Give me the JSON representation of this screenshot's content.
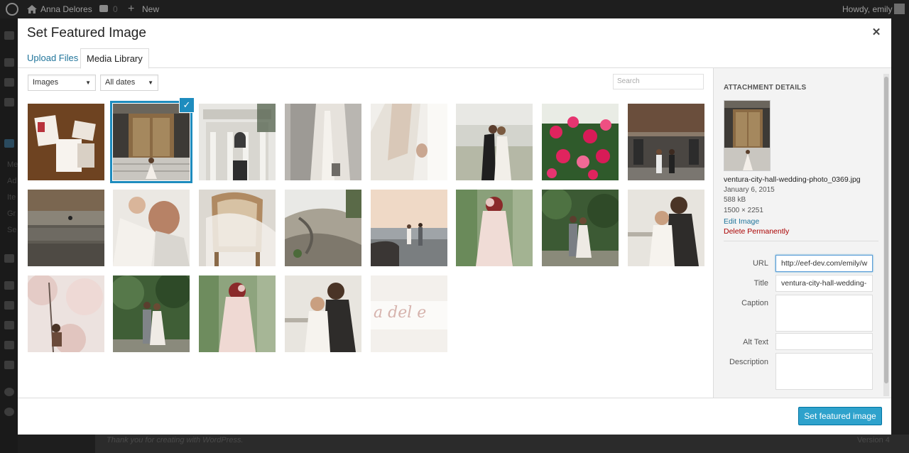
{
  "admin_bar": {
    "site_name": "Anna Delores",
    "comments_count": "0",
    "new_label": "New",
    "greeting": "Howdy, emily"
  },
  "side_menu": {
    "items": [
      "Me",
      "Ad",
      "Ite",
      "Gr",
      "Se"
    ]
  },
  "background_footer": {
    "thanks_text": "Thank you for creating with WordPress.",
    "version_text": "Version 4"
  },
  "modal": {
    "title": "Set Featured Image",
    "tabs": [
      {
        "label": "Upload Files",
        "active": false
      },
      {
        "label": "Media Library",
        "active": true
      }
    ],
    "filters": {
      "type_selected": "Images",
      "date_selected": "All dates",
      "search_placeholder": "Search"
    },
    "grid_items": [
      {
        "name": "stationery",
        "selected": false
      },
      {
        "name": "city-hall-bride",
        "selected": true
      },
      {
        "name": "city-hall-building",
        "selected": false
      },
      {
        "name": "dress-detail",
        "selected": false
      },
      {
        "name": "dress-hand",
        "selected": false
      },
      {
        "name": "couple-kiss-field",
        "selected": false
      },
      {
        "name": "pink-flowers",
        "selected": false
      },
      {
        "name": "couple-brick-building",
        "selected": false
      },
      {
        "name": "stone-steps",
        "selected": false
      },
      {
        "name": "couple-embrace",
        "selected": false
      },
      {
        "name": "vintage-chair",
        "selected": false
      },
      {
        "name": "coastal-rocks",
        "selected": false
      },
      {
        "name": "beach-couple",
        "selected": false
      },
      {
        "name": "bride-bouquet",
        "selected": false
      },
      {
        "name": "garden-couple",
        "selected": false
      },
      {
        "name": "couple-forehead",
        "selected": false
      },
      {
        "name": "blossom-couple",
        "selected": false
      },
      {
        "name": "garden-couple-2",
        "selected": false
      },
      {
        "name": "bride-bouquet-2",
        "selected": false
      },
      {
        "name": "couple-forehead-2",
        "selected": false
      },
      {
        "name": "script-logo",
        "selected": false
      }
    ],
    "logo_script_text": "a del e",
    "attachment": {
      "heading": "ATTACHMENT DETAILS",
      "filename": "ventura-city-hall-wedding-photo_0369.jpg",
      "date": "January 6, 2015",
      "size": "588 kB",
      "dimensions": "1500 × 2251",
      "edit_label": "Edit Image",
      "delete_label": "Delete Permanently"
    },
    "fields": {
      "url_label": "URL",
      "url_value": "http://eef-dev.com/emily/w",
      "title_label": "Title",
      "title_value": "ventura-city-hall-wedding-",
      "caption_label": "Caption",
      "alt_label": "Alt Text",
      "description_label": "Description"
    },
    "primary_button": "Set featured image"
  }
}
